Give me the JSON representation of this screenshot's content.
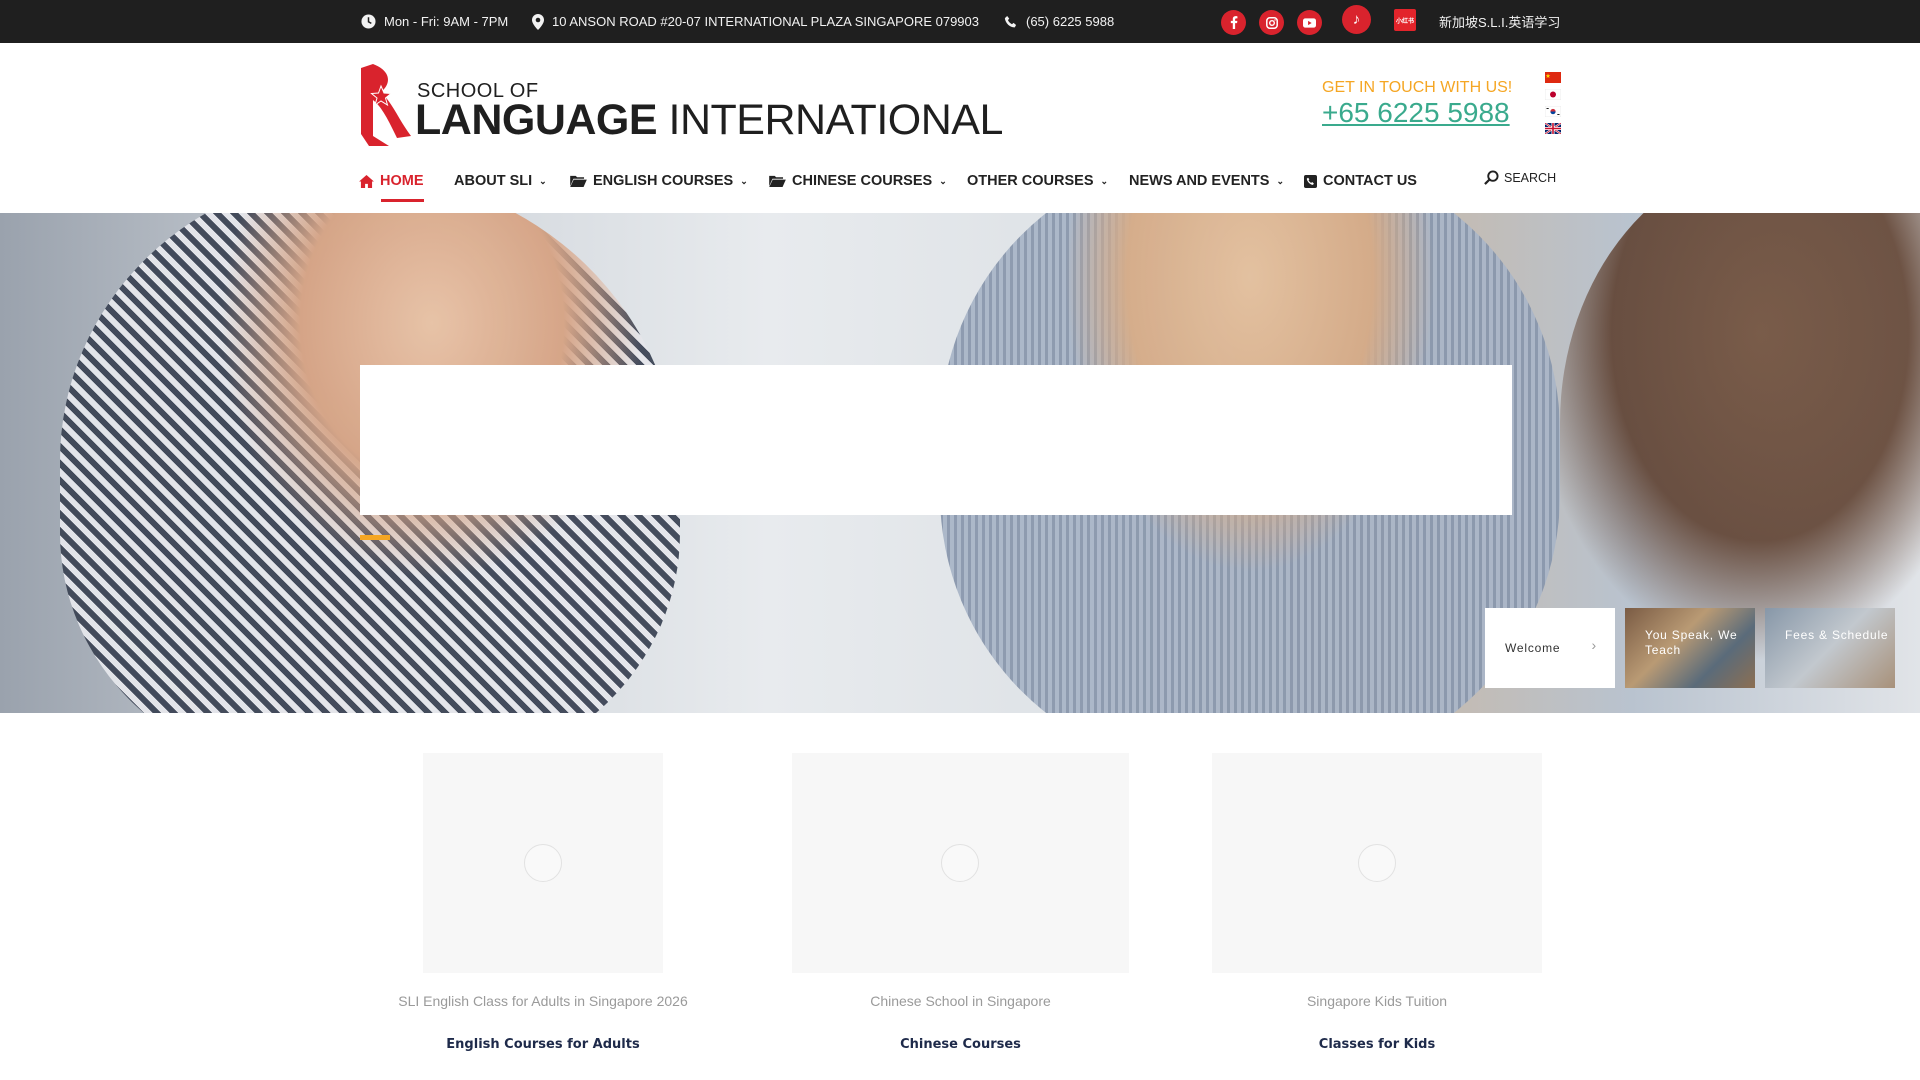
{
  "topbar": {
    "hours": "Mon - Fri: 9AM - 7PM",
    "address": "10 ANSON ROAD #20-07 INTERNATIONAL PLAZA SINGAPORE 079903",
    "phone": "(65) 6225 5988",
    "xhs_badge": "小红书",
    "xhs_label": "新加坡S.L.I.英语学习",
    "social_icons": [
      "facebook-icon",
      "instagram-icon",
      "youtube-icon",
      "tiktok-icon",
      "xiaohongshu-icon"
    ],
    "background": "#1f1f1f",
    "social_color": "#d9232d"
  },
  "logo": {
    "line1": "SCHOOL OF",
    "line2_bold": "LANGUAGE",
    "line2_regular": "INTERNATIONAL"
  },
  "contact": {
    "title": "GET IN TOUCH WITH US!",
    "phone": "+65 6225 5988",
    "title_color": "#f5a623",
    "phone_color": "#3aaa8d"
  },
  "languages": [
    "Chinese",
    "Japanese",
    "Korean",
    "English"
  ],
  "nav": {
    "items": [
      {
        "label": "HOME",
        "icon": "home-icon",
        "active": true
      },
      {
        "label": "ABOUT SLI",
        "dropdown": true
      },
      {
        "label": "ENGLISH COURSES",
        "icon": "folder-open-icon",
        "dropdown": true
      },
      {
        "label": "CHINESE COURSES",
        "icon": "folder-open-icon",
        "dropdown": true
      },
      {
        "label": "OTHER COURSES",
        "dropdown": true
      },
      {
        "label": "NEWS AND EVENTS",
        "dropdown": true
      },
      {
        "label": "CONTACT US",
        "icon": "phone-square-icon"
      }
    ],
    "search_label": "SEARCH",
    "active_color": "#d9232d"
  },
  "hero": {
    "accent_color": "#f5a623",
    "slides": [
      {
        "label": "Welcome"
      },
      {
        "label": "You Speak, We Teach"
      },
      {
        "label": "Fees & Schedule"
      }
    ]
  },
  "cards": [
    {
      "caption": "SLI English Class for Adults in Singapore 2026",
      "link": "English Courses for Adults"
    },
    {
      "caption": "Chinese School in Singapore",
      "link": "Chinese Courses"
    },
    {
      "caption": "Singapore Kids Tuition",
      "link": "Classes for Kids"
    }
  ]
}
